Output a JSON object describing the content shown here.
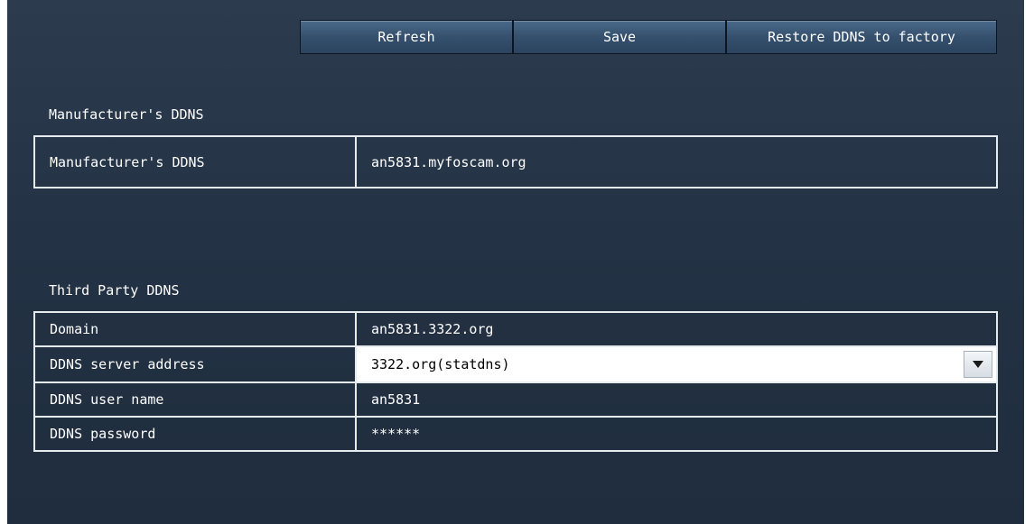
{
  "toolbar": {
    "refresh_label": "Refresh",
    "save_label": "Save",
    "restore_label": "Restore DDNS to factory"
  },
  "manufacturer": {
    "section_title": "Manufacturer's DDNS",
    "rows": [
      {
        "label": "Manufacturer's DDNS",
        "value": "an5831.myfoscam.org"
      }
    ]
  },
  "third_party": {
    "section_title": "Third Party DDNS",
    "domain": {
      "label": "Domain",
      "value": "an5831.3322.org"
    },
    "server": {
      "label": "DDNS server address",
      "value": "3322.org(statdns)",
      "icon": "chevron-down-icon"
    },
    "user": {
      "label": "DDNS user name",
      "value": "an5831"
    },
    "password": {
      "label": "DDNS password",
      "value": "******"
    }
  },
  "colors": {
    "panel_top": "#2c3c4e",
    "panel_bottom": "#1f2d3e",
    "button": "#35506d",
    "grid_line": "#e6ebf0"
  }
}
